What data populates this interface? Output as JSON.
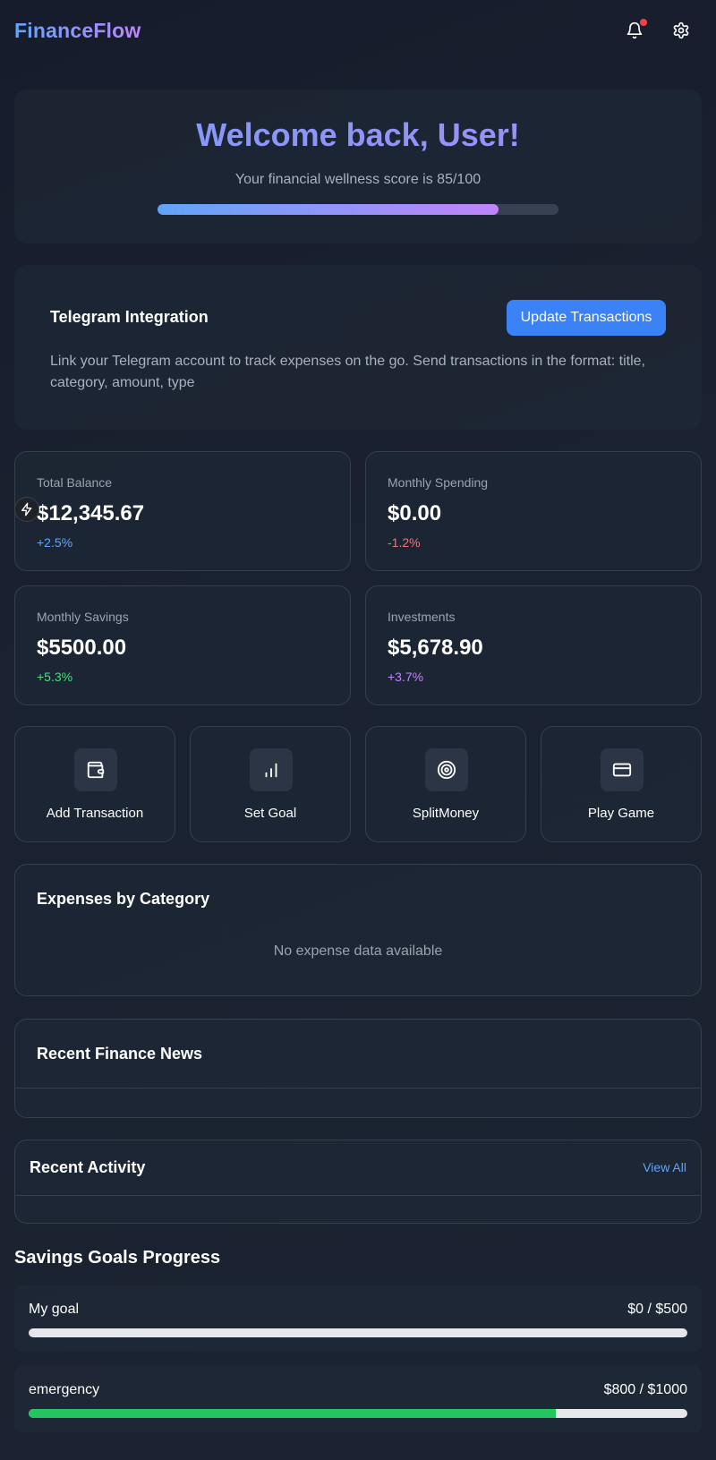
{
  "header": {
    "brand": "FinanceFlow",
    "icons": [
      "bell-icon",
      "gear-icon"
    ]
  },
  "welcome": {
    "title": "Welcome back, User!",
    "subtitle": "Your financial wellness score is 85/100",
    "score": 85,
    "score_max": 100
  },
  "telegram": {
    "title": "Telegram Integration",
    "button": "Update Transactions",
    "description": "Link your Telegram account to track expenses on the go. Send transactions in the format: title, category, amount, type"
  },
  "stats": [
    {
      "label": "Total Balance",
      "value": "$12,345.67",
      "change": "+2.5%",
      "change_color": "#60a5fa"
    },
    {
      "label": "Monthly Spending",
      "value": "$0.00",
      "change": "-1.2%",
      "change_color": "#f87171"
    },
    {
      "label": "Monthly Savings",
      "value": "$5500.00",
      "change": "+5.3%",
      "change_color": "#4ade80"
    },
    {
      "label": "Investments",
      "value": "$5,678.90",
      "change": "+3.7%",
      "change_color": "#c084fc"
    }
  ],
  "actions": [
    {
      "label": "Add Transaction",
      "icon": "wallet-icon"
    },
    {
      "label": "Set Goal",
      "icon": "bar-chart-icon"
    },
    {
      "label": "SplitMoney",
      "icon": "target-icon"
    },
    {
      "label": "Play Game",
      "icon": "credit-card-icon"
    }
  ],
  "expenses": {
    "title": "Expenses by Category",
    "empty": "No expense data available"
  },
  "news": {
    "title": "Recent Finance News"
  },
  "activity": {
    "title": "Recent Activity",
    "view_all": "View All"
  },
  "goals": {
    "heading": "Savings Goals Progress",
    "items": [
      {
        "name": "My goal",
        "amount": "$0 / $500",
        "progress": 0
      },
      {
        "name": "emergency",
        "amount": "$800 / $1000",
        "progress": 0.8
      }
    ]
  },
  "colors": {
    "accent": "#3b82f6",
    "goal_fill": "#22c55e",
    "notification": "#ef4444"
  }
}
